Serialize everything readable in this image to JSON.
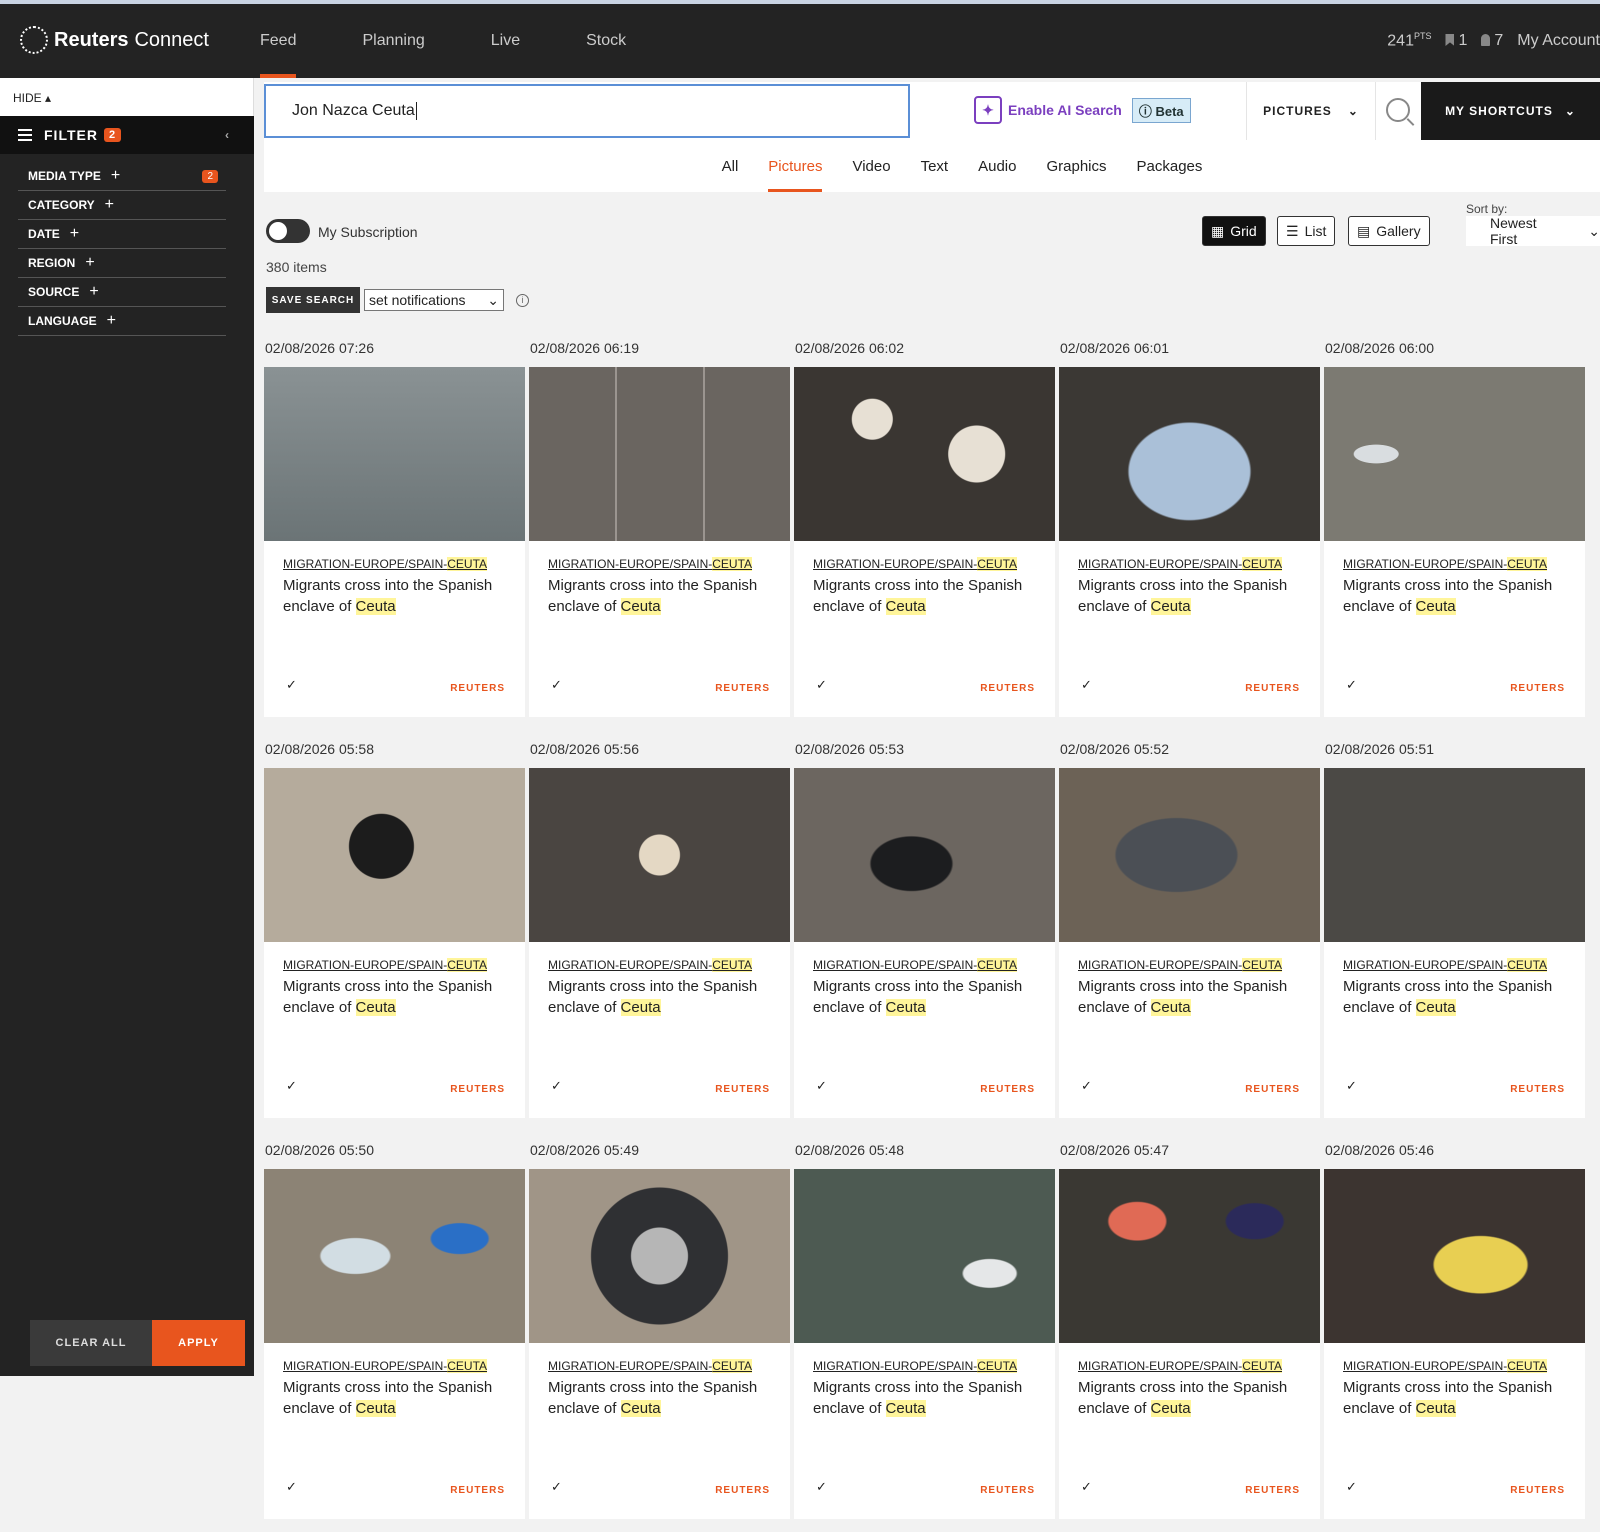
{
  "app": {
    "brand_bold": "Reuters",
    "brand_light": "Connect"
  },
  "nav": [
    "Feed",
    "Planning",
    "Live",
    "Stock"
  ],
  "topbar": {
    "points": "241",
    "points_unit": "PTS",
    "bookmarks": "1",
    "notifications": "7",
    "account": "My Account"
  },
  "sidebar": {
    "hide": "HIDE ▴",
    "filter_label": "FILTER",
    "filter_badge": "2",
    "facets": [
      {
        "label": "MEDIA TYPE",
        "badge": "2"
      },
      {
        "label": "CATEGORY"
      },
      {
        "label": "DATE"
      },
      {
        "label": "REGION"
      },
      {
        "label": "SOURCE"
      },
      {
        "label": "LANGUAGE"
      }
    ],
    "clear_all": "CLEAR ALL",
    "apply": "APPLY"
  },
  "search": {
    "query": "Jon Nazca Ceuta",
    "ai_label": "Enable AI Search",
    "beta": "ⓘ Beta",
    "media_select": "PICTURES",
    "shortcuts": "MY SHORTCUTS"
  },
  "tabs": [
    "All",
    "Pictures",
    "Video",
    "Text",
    "Audio",
    "Graphics",
    "Packages"
  ],
  "active_tab": "Pictures",
  "controls": {
    "subscription": "My Subscription",
    "items": "380 items",
    "save_search": "SAVE SEARCH",
    "notifications": "set notifications",
    "views": [
      "Grid",
      "List",
      "Gallery"
    ],
    "sort_label": "Sort by:",
    "sort_value": "Newest First"
  },
  "card_template": {
    "slug_prefix": "MIGRATION-EUROPE/SPAIN-",
    "slug_hl": "CEUTA",
    "title_pre": "Migrants cross into the Spanish enclave of ",
    "title_hl": "Ceuta",
    "source": "REUTERS"
  },
  "cards": [
    "02/08/2026 07:26",
    "02/08/2026 06:19",
    "02/08/2026 06:02",
    "02/08/2026 06:01",
    "02/08/2026 06:00",
    "02/08/2026 05:58",
    "02/08/2026 05:56",
    "02/08/2026 05:53",
    "02/08/2026 05:52",
    "02/08/2026 05:51",
    "02/08/2026 05:50",
    "02/08/2026 05:49",
    "02/08/2026 05:48",
    "02/08/2026 05:47",
    "02/08/2026 05:46"
  ],
  "colors": {
    "accent": "#e8551e",
    "highlight": "#fff59a",
    "ai": "#7b3fbf"
  }
}
